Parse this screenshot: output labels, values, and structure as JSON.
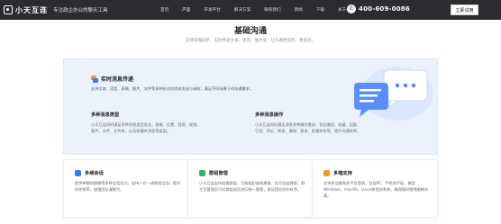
{
  "header": {
    "logo_name": "小天互连",
    "slogan": "专注政企办公的聊天工具",
    "nav": [
      "首页",
      "产品",
      "开发平台",
      "解决方案",
      "联系我们",
      "新闻",
      "下载",
      "关于小天"
    ],
    "active_nav_index": 1,
    "phone": "400-609-0086",
    "cta_label": "立即试用",
    "colors": {
      "bar": "#2b2c30",
      "accent": "#3d7bf5"
    }
  },
  "hero": {
    "title": "基础沟通",
    "subtitle": "支持多端同步，实时传递文本、语音、图片等，让沟通更及时、更高效。"
  },
  "feature": {
    "title": "实时消息传递",
    "description": "支持文本、语音、表情、图片、文件等多种形式的消息发送与接收，满足不同场景下的沟通需求。",
    "items": [
      {
        "title": "多种消息类型",
        "description": "小天互连同时满足多种消息类型发送，表格、位置、音频、视频、图片、文件、文件夹，以及收藏夹消息等类型。"
      },
      {
        "title": "多种消息操作",
        "description": "小天互连同时满足消息多种操作需求，包括撤回、收藏、回复、引用、评论、转发、删除、群发、批量转发等，提升沟通效率。"
      }
    ]
  },
  "cards": [
    {
      "title": "多维会话",
      "icon": "chat-icon",
      "icon_color": "#3d7bf5",
      "description": "提供单聊和群聊等多种会话形式，支持一对一或群组会话，提升协作效率，加强团队凝聚力。"
    },
    {
      "title": "群组管理",
      "icon": "group-icon",
      "icon_color": "#2bb36b",
      "description": "小天互连支持创建群组，可按组织架构建群，也可自由建群，群主及管理员可对群组成员进行统一管理，保证团队协作有序。"
    },
    {
      "title": "多端支持",
      "icon": "devices-icon",
      "icon_color": "#f39a23",
      "description": "支持多设备和多平台登录，包括PC、手机和平板，兼容Windows、macOS、Linux和信创系统，确保随时随地顺畅沟通。"
    }
  ]
}
